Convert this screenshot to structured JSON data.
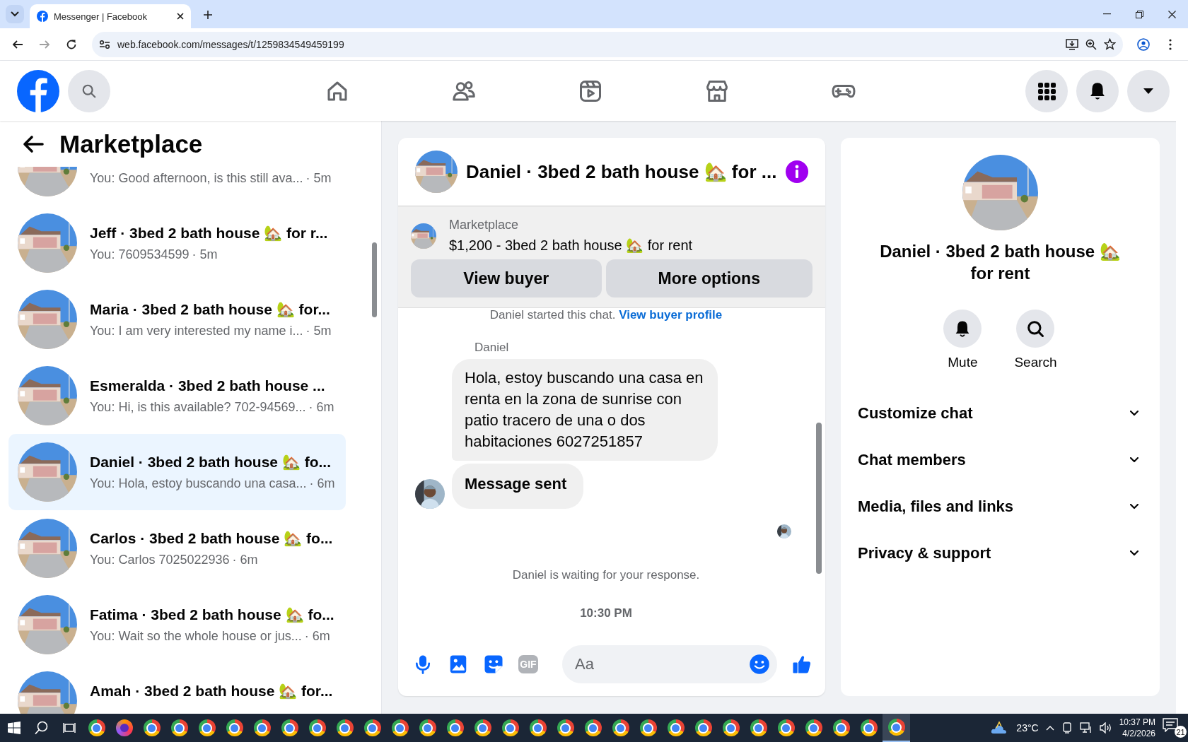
{
  "browser": {
    "tab": {
      "title": "Messenger | Facebook"
    },
    "url": "web.facebook.com/messages/t/1259834549459199"
  },
  "nav": {
    "items": [
      {
        "kind": "home"
      },
      {
        "kind": "friends"
      },
      {
        "kind": "watch"
      },
      {
        "kind": "marketplace"
      },
      {
        "kind": "gaming"
      }
    ]
  },
  "sidebar": {
    "title": "Marketplace",
    "conversations": [
      {
        "preview": "You: Good afternoon, is this still ava...",
        "time": "· 5m",
        "selected": false
      },
      {
        "title": "Jeff · 3bed 2 bath house 🏡 for r...",
        "preview": "You: 7609534599",
        "time": "· 5m",
        "selected": false
      },
      {
        "title": "Maria · 3bed 2 bath house 🏡 for...",
        "preview": "You: I am very interested my name i...",
        "time": "· 5m",
        "selected": false
      },
      {
        "title": "Esmeralda · 3bed 2 bath house ...",
        "preview": "You: Hi, is this available? 702-94569...",
        "time": "· 6m",
        "selected": false
      },
      {
        "title": "Daniel · 3bed 2 bath house 🏡 fo...",
        "preview": "You: Hola, estoy buscando una casa...",
        "time": "· 6m",
        "selected": true
      },
      {
        "title": "Carlos · 3bed 2 bath house 🏡 fo...",
        "preview": "You: Carlos 7025022936",
        "time": "· 6m",
        "selected": false
      },
      {
        "title": "Fatima · 3bed 2 bath house 🏡 fo...",
        "preview": "You: Wait so the whole house or jus...",
        "time": "· 6m",
        "selected": false
      },
      {
        "title": "Amah · 3bed 2 bath house 🏡 for...",
        "selected": false
      }
    ]
  },
  "chat": {
    "title": "Daniel · 3bed 2 bath house 🏡 for ...",
    "listing": {
      "label": "Marketplace",
      "text": "$1,200 - 3bed 2 bath house 🏡 for rent",
      "buttons": [
        "View buyer",
        "More options"
      ]
    },
    "notice": {
      "text": "Daniel started this chat.",
      "link": "View buyer profile"
    },
    "sender": "Daniel",
    "messages": [
      {
        "kind": "text",
        "text": "Hola, estoy buscando una casa en renta en la zona de sunrise con patio tracero de una o dos habitaciones  6027251857"
      },
      {
        "kind": "status",
        "text": "Message sent"
      }
    ],
    "waiting": "Daniel is waiting for your response.",
    "timestamp": "10:30 PM",
    "composer": {
      "placeholder": "Aa",
      "gif_label": "GIF"
    }
  },
  "details": {
    "name": "Daniel · 3bed 2 bath house 🏡 for rent",
    "actions": [
      {
        "kind": "mute",
        "label": "Mute"
      },
      {
        "kind": "search",
        "label": "Search"
      }
    ],
    "sections": [
      {
        "label": "Customize chat",
        "expanded": false
      },
      {
        "label": "Chat members",
        "expanded": false
      },
      {
        "label": "Media, files and links",
        "expanded": false
      },
      {
        "label": "Privacy & support",
        "expanded": false
      }
    ]
  },
  "taskbar": {
    "apps": [
      {
        "kind": "chrome",
        "selected": false
      },
      {
        "kind": "firefox",
        "selected": false
      },
      {
        "kind": "chrome",
        "selected": false
      },
      {
        "kind": "chrome",
        "selected": false
      },
      {
        "kind": "chrome",
        "selected": false
      },
      {
        "kind": "chrome",
        "selected": false
      },
      {
        "kind": "chrome",
        "selected": false
      },
      {
        "kind": "chrome",
        "selected": false
      },
      {
        "kind": "chrome",
        "selected": false
      },
      {
        "kind": "chrome",
        "selected": false
      },
      {
        "kind": "chrome",
        "selected": false
      },
      {
        "kind": "chrome",
        "selected": false
      },
      {
        "kind": "chrome",
        "selected": false
      },
      {
        "kind": "chrome",
        "selected": false
      },
      {
        "kind": "chrome",
        "selected": false
      },
      {
        "kind": "chrome",
        "selected": false
      },
      {
        "kind": "chrome",
        "selected": false
      },
      {
        "kind": "chrome",
        "selected": false
      },
      {
        "kind": "chrome",
        "selected": false
      },
      {
        "kind": "chrome",
        "selected": false
      },
      {
        "kind": "chrome",
        "selected": false
      },
      {
        "kind": "chrome",
        "selected": false
      },
      {
        "kind": "chrome",
        "selected": false
      },
      {
        "kind": "chrome",
        "selected": false
      },
      {
        "kind": "chrome",
        "selected": false
      },
      {
        "kind": "chrome",
        "selected": false
      },
      {
        "kind": "chrome",
        "selected": false
      },
      {
        "kind": "chrome",
        "selected": false
      },
      {
        "kind": "chrome",
        "selected": false
      },
      {
        "kind": "chrome",
        "selected": true
      }
    ],
    "weather": "23°C",
    "time": "10:37 PM",
    "date": "4/2/2026",
    "notifications": "21"
  }
}
